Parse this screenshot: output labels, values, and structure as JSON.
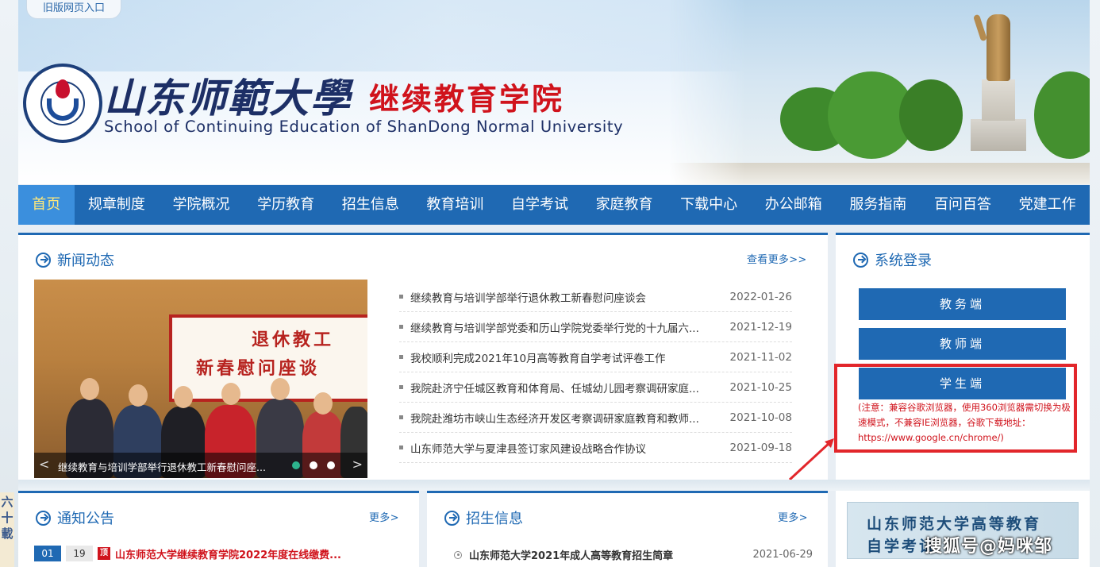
{
  "header": {
    "old_site_link": "旧版网页入口",
    "school_name_cn": "山东师範大學",
    "college_name_cn": "继续教育学院",
    "school_name_en": "School of Continuing Education of ShanDong Normal University"
  },
  "nav": {
    "items": [
      "首页",
      "规章制度",
      "学院概况",
      "学历教育",
      "招生信息",
      "教育培训",
      "自学考试",
      "家庭教育",
      "下载中心",
      "办公邮箱",
      "服务指南",
      "百问百答",
      "党建工作"
    ],
    "active_index": 0
  },
  "news": {
    "title": "新闻动态",
    "more": "查看更多>>",
    "photo": {
      "banner_line1": "退休教工",
      "banner_line2": "新春慰问座谈",
      "caption": "继续教育与培训学部举行退休教工新春慰问座...",
      "prev": "<",
      "next": ">",
      "slide_count": 3,
      "active_slide": 0
    },
    "items": [
      {
        "title": "继续教育与培训学部举行退休教工新春慰问座谈会",
        "date": "2022-01-26"
      },
      {
        "title": "继续教育与培训学部党委和历山学院党委举行党的十九届六...",
        "date": "2021-12-19"
      },
      {
        "title": "我校顺利完成2021年10月高等教育自学考试评卷工作",
        "date": "2021-11-02"
      },
      {
        "title": "我院赴济宁任城区教育和体育局、任城幼儿园考察调研家庭...",
        "date": "2021-10-25"
      },
      {
        "title": "我院赴潍坊市峡山生态经济开发区考察调研家庭教育和教师...",
        "date": "2021-10-08"
      },
      {
        "title": "山东师范大学与夏津县签订家风建设战略合作协议",
        "date": "2021-09-18"
      }
    ]
  },
  "login": {
    "title": "系统登录",
    "buttons": [
      "教务端",
      "教师端",
      "学生端"
    ],
    "notice": "(注意：兼容谷歌浏览器，使用360浏览器需切换为极速模式，不兼容IE浏览器，谷歌下载地址：https://www.google.cn/chrome/)"
  },
  "notices": {
    "title": "通知公告",
    "more": "更多>",
    "first": {
      "month": "01",
      "day": "19",
      "badge": "顶",
      "title": "山东师范大学继续教育学院2022年度在线缴费..."
    }
  },
  "admissions": {
    "title": "招生信息",
    "more": "更多>",
    "first": {
      "title": "山东师范大学2021年成人高等教育招生简章",
      "date": "2021-06-29"
    }
  },
  "side_banner": {
    "line1": "山东师范大学高等教育",
    "line2": "自学考试"
  },
  "watermark": "搜狐号@妈咪邹",
  "left_strip": "六十載",
  "colors": {
    "primary_blue": "#1f69b3",
    "active_nav": "#3b8fdd",
    "alert_red": "#d0131c",
    "highlight_red": "#e2262b"
  }
}
